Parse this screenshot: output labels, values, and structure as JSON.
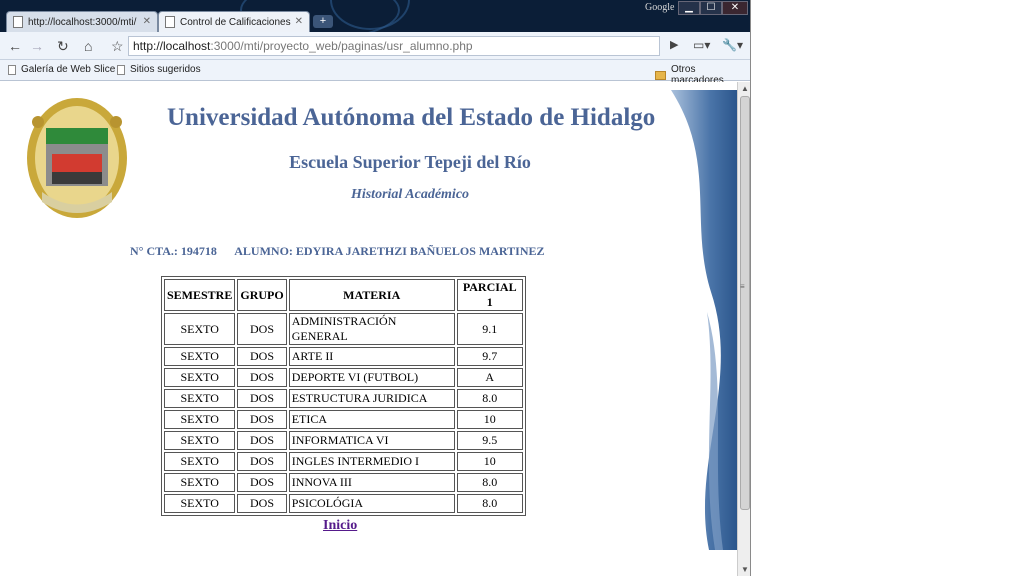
{
  "browser": {
    "tabs": [
      {
        "label": "http://localhost:3000/mti/",
        "active": false
      },
      {
        "label": "Control de Calificaciones",
        "active": true
      }
    ],
    "new_tab": "+",
    "brand": "Google",
    "url_host": "http://localhost",
    "url_rest": ":3000/mti/proyecto_web/paginas/usr_alumno.php",
    "bookmarks": [
      "Galería de Web Slice",
      "Sitios sugeridos"
    ],
    "other_bookmarks": "Otros marcadores"
  },
  "page": {
    "university": "Universidad Autónoma del Estado de Hidalgo",
    "school": "Escuela Superior Tepeji del Río",
    "section": "Historial Académico",
    "student_line": "N° CTA.: 194718      ALUMNO: EDYIRA JARETHZI BAÑUELOS MARTINEZ",
    "table": {
      "headers": [
        "SEMESTRE",
        "GRUPO",
        "MATERIA",
        "PARCIAL 1"
      ],
      "rows": [
        [
          "SEXTO",
          "DOS",
          "ADMINISTRACIÓN GENERAL",
          "9.1"
        ],
        [
          "SEXTO",
          "DOS",
          "ARTE II",
          "9.7"
        ],
        [
          "SEXTO",
          "DOS",
          "DEPORTE VI (FUTBOL)",
          "A"
        ],
        [
          "SEXTO",
          "DOS",
          "ESTRUCTURA JURIDICA",
          "8.0"
        ],
        [
          "SEXTO",
          "DOS",
          "ETICA",
          "10"
        ],
        [
          "SEXTO",
          "DOS",
          "INFORMATICA VI",
          "9.5"
        ],
        [
          "SEXTO",
          "DOS",
          "INGLES INTERMEDIO I",
          "10"
        ],
        [
          "SEXTO",
          "DOS",
          "INNOVA III",
          "8.0"
        ],
        [
          "SEXTO",
          "DOS",
          "PSICOLÓGIA",
          "8.0"
        ]
      ]
    },
    "home_link": "Inicio"
  },
  "colors": {
    "heading": "#4b6596",
    "visited_link": "#551a8b"
  }
}
